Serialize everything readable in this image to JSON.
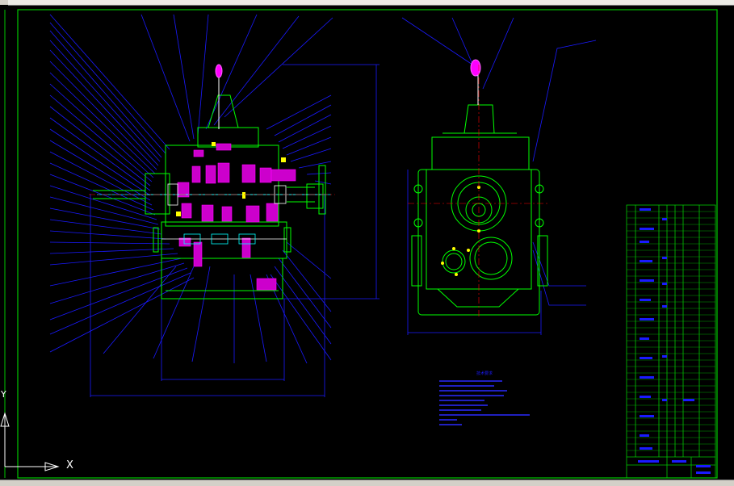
{
  "viewport": {
    "background": "#000000",
    "frame_color": "#00ff00",
    "line_color": "#0000ff",
    "part_color": "#00ff00",
    "hatch_color": "#ff00ff",
    "center_color": "#ff0000"
  },
  "ucs": {
    "x_label": "X",
    "y_label": "Y"
  },
  "notes": {
    "title": "技术要求"
  },
  "title_block": {
    "present": true
  }
}
